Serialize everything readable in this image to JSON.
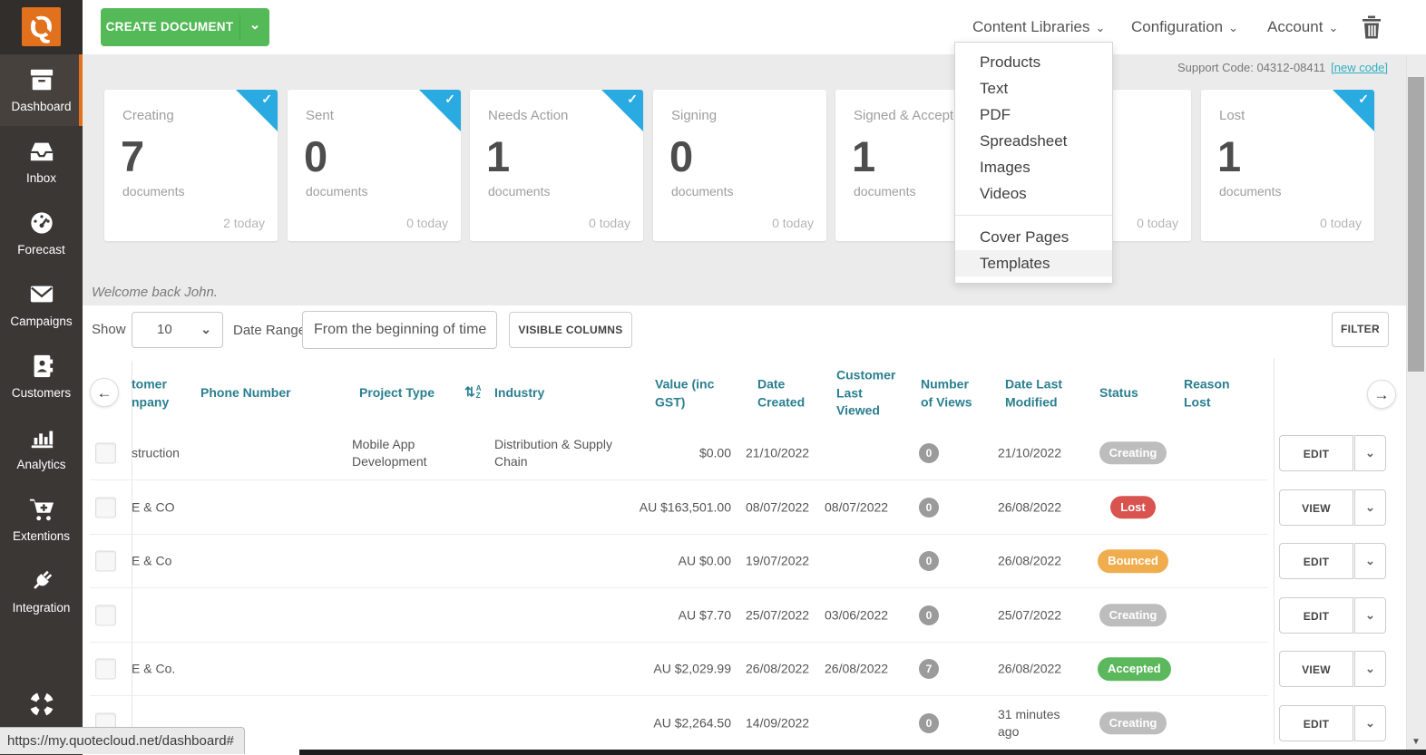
{
  "topbar": {
    "create_button_label": "CREATE DOCUMENT",
    "nav": {
      "content_libraries": "Content Libraries",
      "configuration": "Configuration",
      "account": "Account"
    }
  },
  "content_libraries_menu": {
    "items": [
      "Products",
      "Text",
      "PDF",
      "Spreadsheet",
      "Images",
      "Videos"
    ],
    "items_secondary": [
      "Cover Pages",
      "Templates"
    ],
    "hovered_item": "Templates"
  },
  "sidebar": {
    "items": [
      {
        "label": "Dashboard",
        "icon": "archive-box",
        "active": true
      },
      {
        "label": "Inbox",
        "icon": "inbox-tray",
        "active": false
      },
      {
        "label": "Forecast",
        "icon": "gauge",
        "active": false
      },
      {
        "label": "Campaigns",
        "icon": "envelope",
        "active": false
      },
      {
        "label": "Customers",
        "icon": "address-book",
        "active": false
      },
      {
        "label": "Analytics",
        "icon": "bar-chart",
        "active": false
      },
      {
        "label": "Extentions",
        "icon": "cart-plus",
        "active": false
      },
      {
        "label": "Integration",
        "icon": "plug",
        "active": false
      }
    ],
    "footer_icon": "life-ring"
  },
  "support": {
    "code_label": "Support Code: 04312-08411",
    "new_code_link": "[new code]"
  },
  "cards": [
    {
      "title": "Creating",
      "value": "7",
      "unit": "documents",
      "today": "2 today",
      "ribbon": true
    },
    {
      "title": "Sent",
      "value": "0",
      "unit": "documents",
      "today": "0 today",
      "ribbon": true
    },
    {
      "title": "Needs Action",
      "value": "1",
      "unit": "documents",
      "today": "0 today",
      "ribbon": true
    },
    {
      "title": "Signing",
      "value": "0",
      "unit": "documents",
      "today": "0 today",
      "ribbon": false
    },
    {
      "title": "Signed & Accepted",
      "value": "1",
      "unit": "documents",
      "today": "",
      "ribbon": false
    },
    {
      "title": "",
      "value": "",
      "unit": "",
      "today": "0 today",
      "ribbon": false
    },
    {
      "title": "Lost",
      "value": "1",
      "unit": "documents",
      "today": "0 today",
      "ribbon": true
    }
  ],
  "welcome_text": "Welcome back John.",
  "controls": {
    "show_label": "Show",
    "show_value": "10",
    "date_range_label": "Date Range",
    "date_range_value": "From the beginning of time",
    "visible_columns_label": "VISIBLE COLUMNS",
    "filter_label": "FILTER"
  },
  "table": {
    "headers": {
      "customer_company": "tomer\nnpany",
      "phone_number": "Phone Number",
      "project_type": "Project Type",
      "industry": "Industry",
      "value": "Value (inc GST)",
      "date_created": "Date Created",
      "customer_last_viewed": "Customer Last Viewed",
      "number_of_views": "Number of Views",
      "date_last_modified": "Date Last Modified",
      "status": "Status",
      "reason_lost": "Reason Lost"
    },
    "rows": [
      {
        "company": "struction",
        "project_type": "Mobile App Development",
        "industry": "Distribution & Supply Chain",
        "value": "$0.00",
        "date_created": "21/10/2022",
        "last_viewed": "",
        "views": "0",
        "last_modified": "21/10/2022",
        "status": "Creating",
        "status_color": "#bdbdbd",
        "action": "EDIT"
      },
      {
        "company": "E & CO",
        "project_type": "",
        "industry": "",
        "value": "AU $163,501.00",
        "date_created": "08/07/2022",
        "last_viewed": "08/07/2022",
        "views": "0",
        "last_modified": "26/08/2022",
        "status": "Lost",
        "status_color": "#d9534f",
        "action": "VIEW"
      },
      {
        "company": "E & Co",
        "project_type": "",
        "industry": "",
        "value": "AU $0.00",
        "date_created": "19/07/2022",
        "last_viewed": "",
        "views": "0",
        "last_modified": "26/08/2022",
        "status": "Bounced",
        "status_color": "#f0ad4e",
        "action": "EDIT"
      },
      {
        "company": "",
        "project_type": "",
        "industry": "",
        "value": "AU $7.70",
        "date_created": "25/07/2022",
        "last_viewed": "03/06/2022",
        "views": "0",
        "last_modified": "25/07/2022",
        "status": "Creating",
        "status_color": "#bdbdbd",
        "action": "EDIT"
      },
      {
        "company": "E & Co.",
        "project_type": "",
        "industry": "",
        "value": "AU $2,029.99",
        "date_created": "26/08/2022",
        "last_viewed": "26/08/2022",
        "views": "7",
        "last_modified": "26/08/2022",
        "status": "Accepted",
        "status_color": "#5cb85c",
        "action": "VIEW"
      },
      {
        "company": "",
        "project_type": "",
        "industry": "",
        "value": "AU $2,264.50",
        "date_created": "14/09/2022",
        "last_viewed": "",
        "views": "0",
        "last_modified": "31 minutes ago",
        "status": "Creating",
        "status_color": "#bdbdbd",
        "action": "EDIT"
      }
    ]
  },
  "statusbar": {
    "url": "https://my.quotecloud.net/dashboard#"
  },
  "colors": {
    "accent_orange": "#e2711d",
    "ribbon_blue": "#29aae1",
    "table_header_teal": "#2a7f90",
    "link_teal": "#31b0bf"
  }
}
